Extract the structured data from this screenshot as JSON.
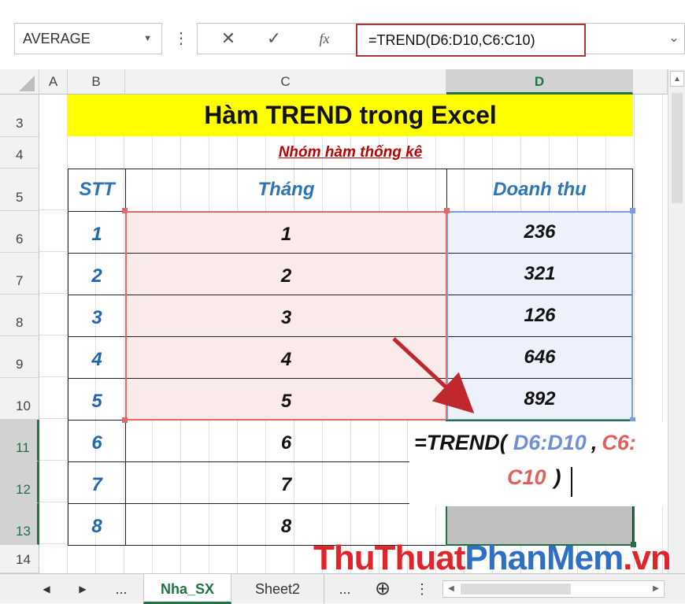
{
  "formula_bar": {
    "name_box": "AVERAGE",
    "cancel_glyph": "✕",
    "enter_glyph": "✓",
    "fx_label": "fx",
    "formula": "=TREND(D6:D10,C6:C10)"
  },
  "columns": [
    "A",
    "B",
    "C",
    "D"
  ],
  "rows": [
    "3",
    "4",
    "5",
    "6",
    "7",
    "8",
    "9",
    "10",
    "11",
    "12",
    "13",
    "14"
  ],
  "sheet": {
    "title": "Hàm TREND trong Excel",
    "subtitle": "Nhóm hàm thống kê",
    "headers": {
      "stt": "STT",
      "thang": "Tháng",
      "doanh_thu": "Doanh thu"
    },
    "data_rows": [
      {
        "stt": "1",
        "thang": "1",
        "doanh_thu": "236"
      },
      {
        "stt": "2",
        "thang": "2",
        "doanh_thu": "321"
      },
      {
        "stt": "3",
        "thang": "3",
        "doanh_thu": "126"
      },
      {
        "stt": "4",
        "thang": "4",
        "doanh_thu": "646"
      },
      {
        "stt": "5",
        "thang": "5",
        "doanh_thu": "892"
      }
    ],
    "forecast_rows": [
      {
        "stt": "6",
        "thang": "6"
      },
      {
        "stt": "7",
        "thang": "7"
      },
      {
        "stt": "8",
        "thang": "8"
      }
    ]
  },
  "cell_editor": {
    "prefix": "=TREND(",
    "ref1": "D6:D10",
    "comma": ",",
    "ref2_part1": "C6:",
    "ref2_part2": "C10",
    "suffix": ")"
  },
  "tabs": {
    "items": [
      "Nha_SX",
      "Sheet2"
    ],
    "ellipsis": "...",
    "add_glyph": "⊕"
  },
  "watermark": {
    "part1": "ThuThuat",
    "part2": "PhanMem",
    "part3": ".vn"
  },
  "colors": {
    "accent_green": "#217346",
    "title_fill": "#ffff00",
    "ref_blue": "#6f8fd6",
    "ref_red": "#e06060",
    "arrow_red": "#c0282d"
  }
}
